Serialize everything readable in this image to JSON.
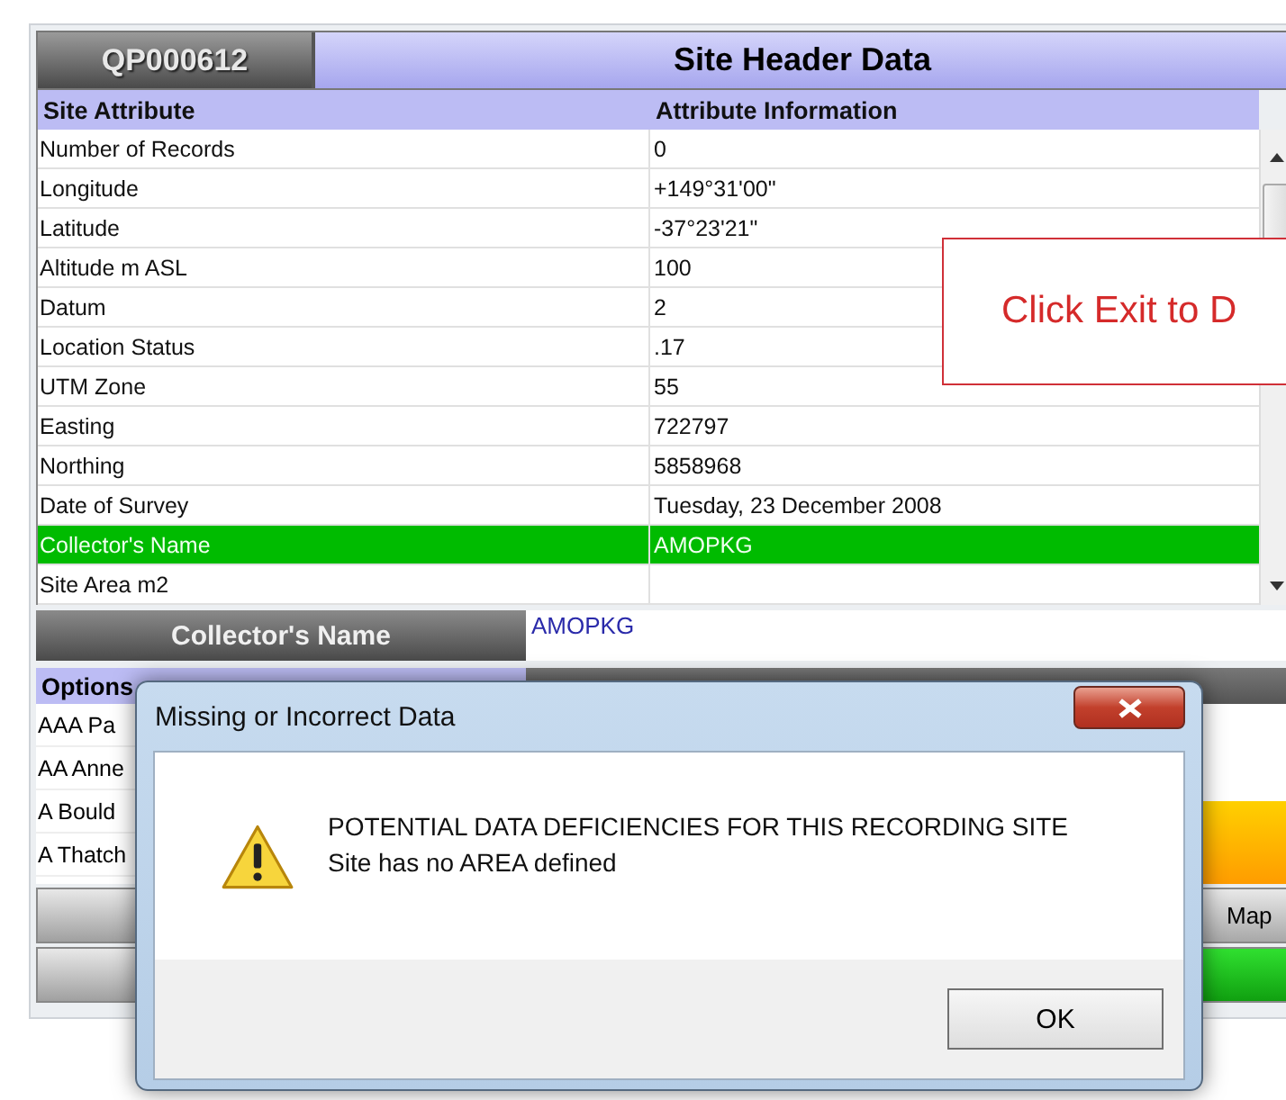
{
  "header": {
    "site_id": "QP000612",
    "title": "Site Header Data"
  },
  "table": {
    "columns": [
      "Site Attribute",
      "Attribute Information"
    ],
    "rows": [
      {
        "attribute": "Number of Records",
        "value": "0",
        "selected": false
      },
      {
        "attribute": "Longitude",
        "value": "+149°31'00\"",
        "selected": false
      },
      {
        "attribute": "Latitude",
        "value": "-37°23'21\"",
        "selected": false
      },
      {
        "attribute": "Altitude m ASL",
        "value": "100",
        "selected": false
      },
      {
        "attribute": "Datum",
        "value": "2",
        "selected": false
      },
      {
        "attribute": "Location Status",
        "value": ".17",
        "selected": false
      },
      {
        "attribute": "UTM Zone",
        "value": "55",
        "selected": false
      },
      {
        "attribute": "Easting",
        "value": "722797",
        "selected": false
      },
      {
        "attribute": "Northing",
        "value": "5858968",
        "selected": false
      },
      {
        "attribute": "Date of Survey",
        "value": "Tuesday, 23 December 2008",
        "selected": false
      },
      {
        "attribute": "Collector's Name",
        "value": "AMOPKG",
        "selected": true
      },
      {
        "attribute": "Site Area m2",
        "selected": false
      }
    ]
  },
  "callout": {
    "text": "Click Exit to D"
  },
  "collector": {
    "label": "Collector's Name",
    "value": "AMOPKG"
  },
  "options": {
    "title": "Options",
    "items": [
      "AAA Pa",
      "AA Anne",
      "A Bould",
      "A Thatch"
    ]
  },
  "side_button": {
    "label": "Map"
  },
  "dialog": {
    "title": "Missing or Incorrect Data",
    "lines": [
      "POTENTIAL DATA DEFICIENCIES FOR THIS RECORDING SITE",
      "Site has no AREA defined"
    ],
    "button": "OK"
  }
}
